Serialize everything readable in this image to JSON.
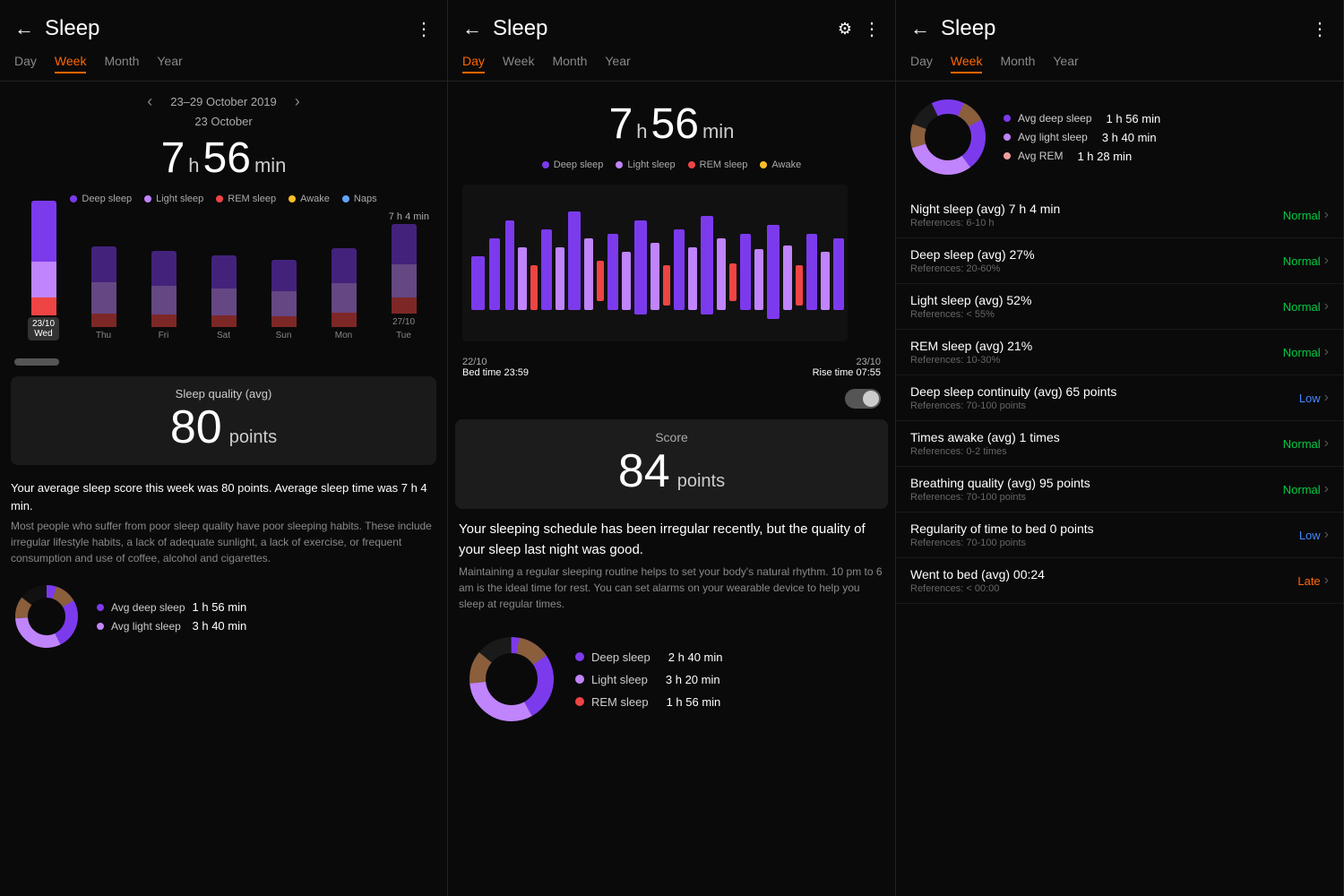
{
  "panel1": {
    "title": "Sleep",
    "tabs": [
      "Day",
      "Week",
      "Month",
      "Year"
    ],
    "active_tab": "Week",
    "date_range": "23–29 October 2019",
    "day_label": "23 October",
    "sleep_hours": "7",
    "sleep_min": "56",
    "legend": [
      {
        "label": "Deep sleep",
        "color": "#7c3aed"
      },
      {
        "label": "Light sleep",
        "color": "#c084fc"
      },
      {
        "label": "REM sleep",
        "color": "#ef4444"
      },
      {
        "label": "Awake",
        "color": "#fbbf24"
      },
      {
        "label": "Naps",
        "color": "#60a5fa"
      }
    ],
    "avg_label": "7 h 4 min",
    "bars": [
      {
        "day": "23/10\nWed",
        "selected": true,
        "deep": 70,
        "light": 40,
        "rem": 20
      },
      {
        "day": "Thu",
        "deep": 50,
        "light": 50,
        "rem": 20
      },
      {
        "day": "Fri",
        "deep": 45,
        "light": 45,
        "rem": 15
      },
      {
        "day": "Sat",
        "deep": 40,
        "light": 40,
        "rem": 15
      },
      {
        "day": "Sun",
        "deep": 35,
        "light": 35,
        "rem": 12
      },
      {
        "day": "Mon",
        "deep": 45,
        "light": 40,
        "rem": 18
      },
      {
        "day": "27/10\nTue",
        "deep": 55,
        "light": 45,
        "rem": 20
      }
    ],
    "score_label": "Sleep quality (avg)",
    "score_value": "80",
    "score_unit": "points",
    "desc_title": "Your average sleep score this week was 80 points. Average sleep time was 7 h 4 min.",
    "desc_body": "Most people who suffer from poor sleep quality have poor sleeping habits. These include irregular lifestyle habits, a lack of adequate sunlight, a lack of exercise, or frequent consumption and use of coffee, alcohol and cigarettes.",
    "donut": {
      "avg_deep_label": "Avg deep sleep",
      "avg_deep_val": "1 h 56 min",
      "avg_light_label": "Avg light sleep",
      "avg_light_val": "3 h 40 min"
    }
  },
  "panel2": {
    "title": "Sleep",
    "tabs": [
      "Day",
      "Week",
      "Month",
      "Year"
    ],
    "active_tab": "Day",
    "sleep_hours": "7",
    "sleep_min": "56",
    "legend": [
      {
        "label": "Deep sleep",
        "color": "#7c3aed"
      },
      {
        "label": "Light sleep",
        "color": "#c084fc"
      },
      {
        "label": "REM sleep",
        "color": "#ef4444"
      },
      {
        "label": "Awake",
        "color": "#fbbf24"
      }
    ],
    "bed_time": "22/10\nBed time 23:59",
    "rise_time": "23/10\nRise time 07:55",
    "score_label": "Score",
    "score_value": "84",
    "score_unit": "points",
    "desc_title": "Your sleeping schedule has been irregular recently, but the quality of your sleep last night was good.",
    "desc_body": "Maintaining a regular sleeping routine helps to set your body's natural rhythm. 10 pm to 6 am is the ideal time for rest. You can set alarms on your wearable device to help you sleep at regular times.",
    "donut": {
      "deep_label": "Deep sleep",
      "deep_val": "2 h 40 min",
      "light_label": "Light sleep",
      "light_val": "3 h 20 min",
      "rem_label": "REM sleep",
      "rem_val": "1 h 56 min"
    }
  },
  "panel3": {
    "title": "Sleep",
    "tabs": [
      "Day",
      "Week",
      "Month",
      "Year"
    ],
    "active_tab": "Week",
    "donut": {
      "avg_deep_label": "Avg deep sleep",
      "avg_deep_val": "1 h 56 min",
      "avg_light_label": "Avg light sleep",
      "avg_light_val": "3 h 40 min",
      "avg_rem_label": "Avg REM",
      "avg_rem_val": "1 h 28 min"
    },
    "metrics": [
      {
        "title": "Night sleep (avg)  7 h 4 min",
        "ref": "References: 6-10 h",
        "status": "Normal",
        "status_class": "status-normal"
      },
      {
        "title": "Deep sleep (avg)  27%",
        "ref": "References: 20-60%",
        "status": "Normal",
        "status_class": "status-normal"
      },
      {
        "title": "Light sleep (avg)  52%",
        "ref": "References: < 55%",
        "status": "Normal",
        "status_class": "status-normal"
      },
      {
        "title": "REM sleep (avg)  21%",
        "ref": "References: 10-30%",
        "status": "Normal",
        "status_class": "status-normal"
      },
      {
        "title": "Deep sleep continuity (avg)  65 points",
        "ref": "References: 70-100 points",
        "status": "Low",
        "status_class": "status-low"
      },
      {
        "title": "Times awake (avg)  1 times",
        "ref": "References: 0-2 times",
        "status": "Normal",
        "status_class": "status-normal"
      },
      {
        "title": "Breathing quality (avg)  95 points",
        "ref": "References: 70-100 points",
        "status": "Normal",
        "status_class": "status-normal"
      },
      {
        "title": "Regularity of time to bed  0 points",
        "ref": "References: 70-100 points",
        "status": "Low",
        "status_class": "status-low"
      },
      {
        "title": "Went to bed (avg)  00:24",
        "ref": "References: < 00:00",
        "status": "Late",
        "status_class": "status-late"
      }
    ]
  }
}
